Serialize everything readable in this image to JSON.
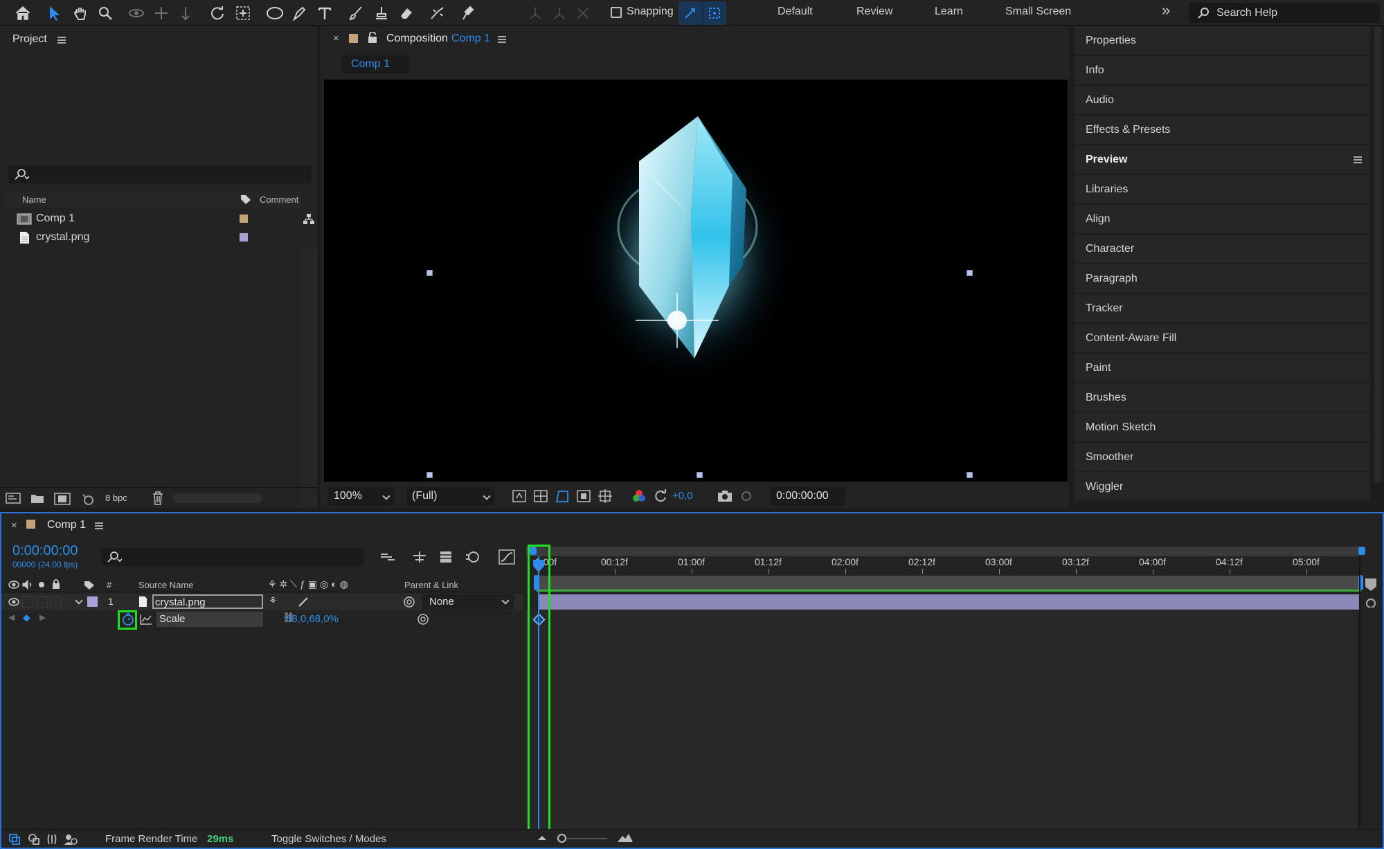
{
  "toolbar": {
    "snapping_label": "Snapping",
    "workspaces": [
      "Default",
      "Review",
      "Learn",
      "Small Screen"
    ],
    "more_label": "»",
    "search_placeholder": "Search Help"
  },
  "project": {
    "title": "Project",
    "columns": {
      "name": "Name",
      "comment": "Comment"
    },
    "items": [
      {
        "name": "Comp 1",
        "type": "composition",
        "label_color": "#c4a27a"
      },
      {
        "name": "crystal.png",
        "type": "footage",
        "label_color": "#a7a3d6"
      }
    ],
    "bpc_label": "8 bpc"
  },
  "composition": {
    "panel_prefix": "Composition",
    "comp_name": "Comp 1",
    "tab_label": "Comp 1",
    "zoom": "100%",
    "resolution": "(Full)",
    "exposure": "+0,0",
    "timecode": "0:00:00:00"
  },
  "right_panels": [
    "Properties",
    "Info",
    "Audio",
    "Effects & Presets",
    "Preview",
    "Libraries",
    "Align",
    "Character",
    "Paragraph",
    "Tracker",
    "Content-Aware Fill",
    "Paint",
    "Brushes",
    "Motion Sketch",
    "Smoother",
    "Wiggler"
  ],
  "right_panels_active": "Preview",
  "timeline": {
    "tab_label": "Comp 1",
    "current_time": "0:00:00:00",
    "frame_info": "00000 (24.00 fps)",
    "headers": {
      "num": "#",
      "source": "Source Name",
      "parent": "Parent & Link"
    },
    "layer": {
      "index": "1",
      "name": "crystal.png",
      "parent": "None",
      "label_color": "#a7a3d6"
    },
    "property": {
      "name": "Scale",
      "value": "68,0,68,0%"
    },
    "ruler": [
      "0:00f",
      "00:12f",
      "01:00f",
      "01:12f",
      "02:00f",
      "02:12f",
      "03:00f",
      "03:12f",
      "04:00f",
      "04:12f",
      "05:00f"
    ],
    "footer": {
      "frame_render_label": "Frame Render Time",
      "frame_render_value": "29ms",
      "toggle_label": "Toggle Switches / Modes"
    }
  },
  "colors": {
    "accent_blue": "#2d8ceb",
    "highlight_green": "#1fe11f",
    "layer_bar": "#8c88b8",
    "work_area_green": "#3fae3f"
  }
}
